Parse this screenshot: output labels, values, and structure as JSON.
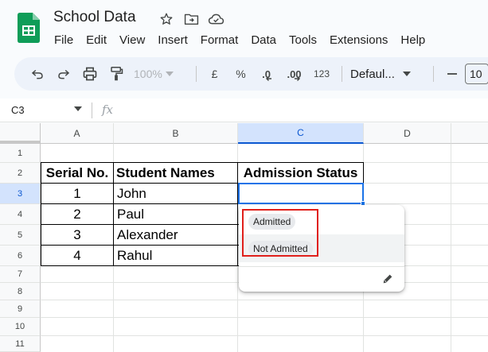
{
  "app": {
    "title": "School Data",
    "icons": [
      "star-icon",
      "move-to-folder-icon",
      "cloud-status-icon"
    ],
    "colors": {
      "sheets_green": "#0f9d58",
      "accent_blue": "#0b57d0",
      "highlight_red": "#e0201b"
    }
  },
  "menu": [
    "File",
    "Edit",
    "View",
    "Insert",
    "Format",
    "Data",
    "Tools",
    "Extensions",
    "Help"
  ],
  "toolbar": {
    "zoom": "100%",
    "currency": "£",
    "percent": "%",
    "decrease_decimal": ".0",
    "increase_decimal": ".00",
    "number_format": "123",
    "font": "Defaul...",
    "font_size": "10"
  },
  "formula_bar": {
    "name_box": "C3",
    "fx": "fx"
  },
  "grid": {
    "columns": [
      "A",
      "B",
      "C",
      "D"
    ],
    "rows": [
      "1",
      "2",
      "3",
      "4",
      "5",
      "6",
      "7",
      "8",
      "9",
      "10",
      "11"
    ],
    "selected_column": "C",
    "selected_row": "3",
    "table": {
      "headers": [
        "Serial No.",
        "Student Names",
        "Admission Status"
      ],
      "rows": [
        [
          "1",
          "John",
          ""
        ],
        [
          "2",
          "Paul",
          ""
        ],
        [
          "3",
          "Alexander",
          ""
        ],
        [
          "4",
          "Rahul",
          ""
        ]
      ]
    }
  },
  "dropdown": {
    "options": [
      "Admitted",
      "Not Admitted"
    ]
  }
}
